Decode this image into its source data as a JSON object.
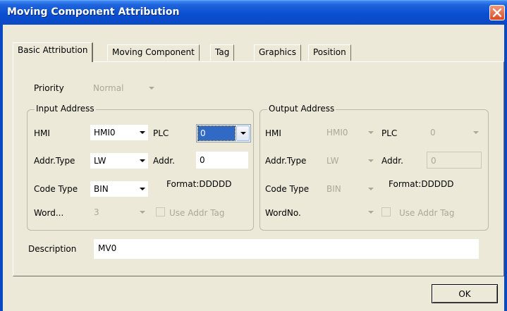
{
  "window": {
    "title": "Moving Component Attribution",
    "close_icon": "close-icon"
  },
  "tabs": [
    "Basic Attribution",
    "Moving Component",
    "Tag",
    "Graphics",
    "Position"
  ],
  "priority": {
    "label": "Priority",
    "value": "Normal"
  },
  "input_address": {
    "legend": "Input Address",
    "hmi_label": "HMI",
    "hmi_value": "HMI0",
    "plc_label": "PLC",
    "plc_value": "0",
    "addr_type_label": "Addr.Type",
    "addr_type_value": "LW",
    "addr_label": "Addr.",
    "addr_value": "0",
    "code_type_label": "Code Type",
    "code_type_value": "BIN",
    "format": "Format:DDDDD",
    "word_label": "Word...",
    "word_value": "3",
    "use_addr_tag": "Use Addr Tag"
  },
  "output_address": {
    "legend": "Output Address",
    "hmi_label": "HMI",
    "hmi_value": "HMI0",
    "plc_label": "PLC",
    "plc_value": "0",
    "addr_type_label": "Addr.Type",
    "addr_type_value": "LW",
    "addr_label": "Addr.",
    "addr_value": "0",
    "code_type_label": "Code Type",
    "code_type_value": "BIN",
    "format": "Format:DDDDD",
    "word_label": "WordNo.",
    "word_value": "",
    "use_addr_tag": "Use Addr Tag"
  },
  "description": {
    "label": "Description",
    "value": "MV0"
  },
  "buttons": {
    "ok": "OK"
  },
  "colors": {
    "titlebar": "#0b48c4",
    "dialog_bg": "#ece9d8",
    "selection": "#316ac5",
    "disabled_text": "#aca899"
  }
}
